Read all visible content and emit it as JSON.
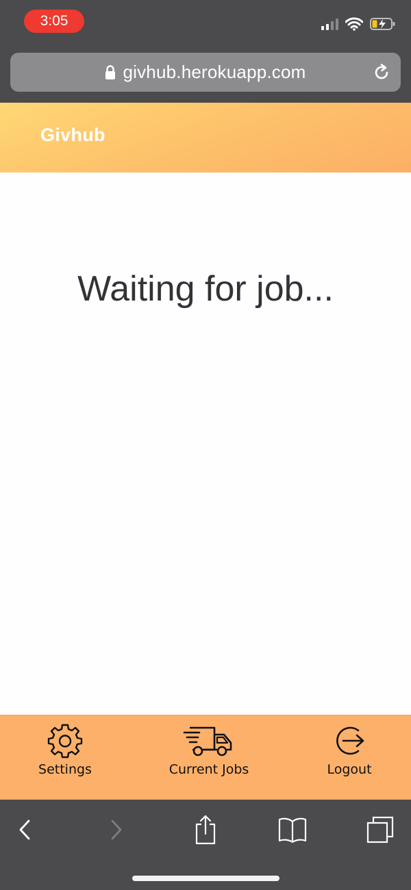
{
  "status_bar": {
    "time": "3:05",
    "signal_icon": "cellular-signal-icon",
    "wifi_icon": "wifi-icon",
    "battery_icon": "battery-charging-icon"
  },
  "browser": {
    "url": "givhub.herokuapp.com",
    "lock_icon": "lock-icon",
    "reload_icon": "reload-icon"
  },
  "app": {
    "brand": "Givhub",
    "status_message": "Waiting for job...",
    "accent_color": "#fdb06a"
  },
  "nav": {
    "items": [
      {
        "label": "Settings",
        "icon": "gear-icon"
      },
      {
        "label": "Current Jobs",
        "icon": "truck-icon"
      },
      {
        "label": "Logout",
        "icon": "logout-icon"
      }
    ]
  },
  "toolbar": {
    "icons": [
      "back-icon",
      "forward-icon",
      "share-icon",
      "bookmarks-icon",
      "tabs-icon"
    ]
  }
}
